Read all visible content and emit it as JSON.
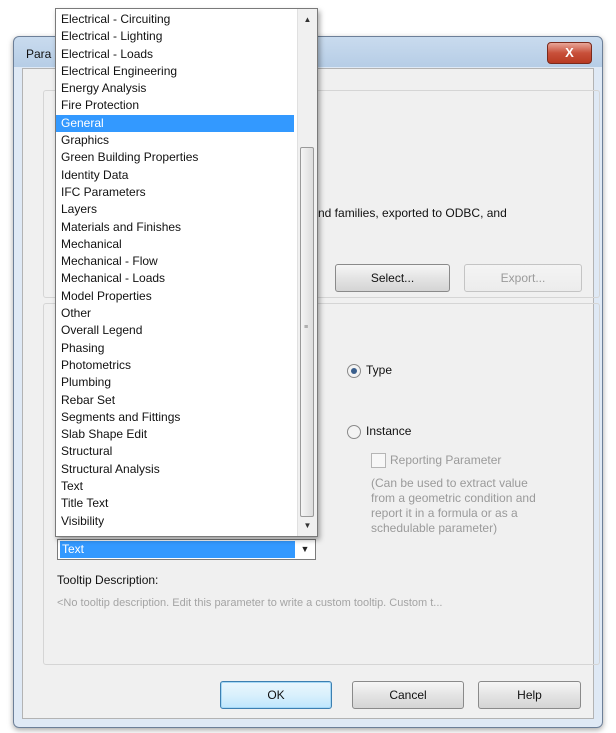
{
  "dialog": {
    "title": "Para",
    "close_label": "X"
  },
  "description_partial": "nd families, exported to ODBC, and",
  "buttons": {
    "select": "Select...",
    "export": "Export...",
    "ok": "OK",
    "cancel": "Cancel",
    "help": "Help"
  },
  "radios": {
    "type": "Type",
    "instance": "Instance"
  },
  "reporting_parameter": "Reporting Parameter",
  "reporting_note": "(Can be used to extract value\nfrom a geometric condition and\nreport it in a formula or as a\nschedulable parameter)",
  "group_dropdown": {
    "selected_value": "Text",
    "highlighted": "General",
    "items": [
      "Electrical - Circuiting",
      "Electrical - Lighting",
      "Electrical - Loads",
      "Electrical Engineering",
      "Energy Analysis",
      "Fire Protection",
      "General",
      "Graphics",
      "Green Building Properties",
      "Identity Data",
      "IFC Parameters",
      "Layers",
      "Materials and Finishes",
      "Mechanical",
      "Mechanical - Flow",
      "Mechanical - Loads",
      "Model Properties",
      "Other",
      "Overall Legend",
      "Phasing",
      "Photometrics",
      "Plumbing",
      "Rebar Set",
      "Segments and Fittings",
      "Slab Shape Edit",
      "Structural",
      "Structural Analysis",
      "Text",
      "Title Text",
      "Visibility"
    ]
  },
  "tooltip": {
    "label": "Tooltip Description:",
    "placeholder": "<No tooltip description. Edit this parameter to write a custom tooltip. Custom t..."
  },
  "icons": {
    "scroll_up": "scroll-up-arrow-icon",
    "scroll_down": "scroll-down-arrow-icon",
    "dropdown": "chevron-down-icon"
  }
}
